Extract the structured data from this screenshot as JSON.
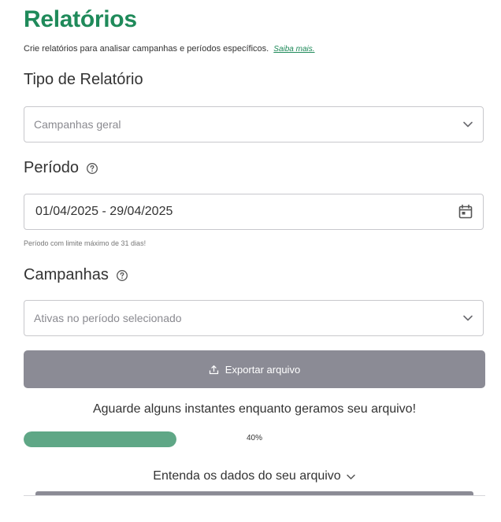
{
  "page": {
    "title": "Relatórios",
    "subtitle": "Crie relatórios para analisar campanhas e períodos específicos.",
    "learn_more_link": "Saiba mais."
  },
  "report_type": {
    "label": "Tipo de Relatório",
    "placeholder": "Campanhas geral",
    "icon": "chevron-down-icon"
  },
  "period": {
    "label": "Período",
    "value": "01/04/2025 - 29/04/2025",
    "hint": "Período com limite máximo de 31 dias!",
    "icon": "calendar-icon"
  },
  "campaigns": {
    "label": "Campanhas",
    "placeholder": "Ativas no período selecionado",
    "icon": "chevron-down-icon"
  },
  "export": {
    "button_label": "Exportar arquivo",
    "icon": "upload-icon",
    "wait_message": "Aguarde alguns instantes enquanto geramos seu arquivo!",
    "progress_percent": 40,
    "progress_label": "40%"
  },
  "footer": {
    "understand_label": "Entenda os dados do seu arquivo"
  },
  "colors": {
    "brand_green": "#1f8a5a",
    "progress_green": "#5fa786",
    "button_gray": "#8b8b95"
  }
}
